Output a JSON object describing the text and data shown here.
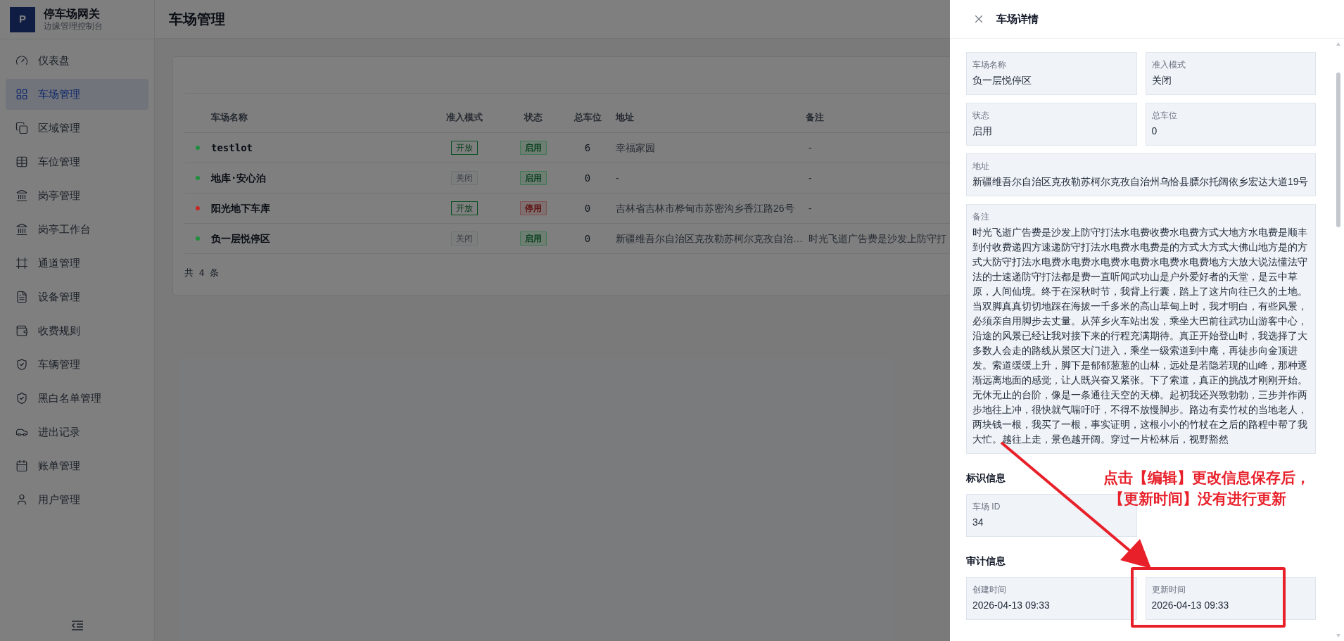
{
  "sidebar": {
    "logo": "P",
    "title": "停车场网关",
    "subtitle": "边缘管理控制台",
    "items": [
      {
        "label": "仪表盘",
        "selected": false
      },
      {
        "label": "车场管理",
        "selected": true
      },
      {
        "label": "区域管理",
        "selected": false
      },
      {
        "label": "车位管理",
        "selected": false
      },
      {
        "label": "岗亭管理",
        "selected": false
      },
      {
        "label": "岗亭工作台",
        "selected": false
      },
      {
        "label": "通道管理",
        "selected": false
      },
      {
        "label": "设备管理",
        "selected": false
      },
      {
        "label": "收费规则",
        "selected": false
      },
      {
        "label": "车辆管理",
        "selected": false
      },
      {
        "label": "黑白名单管理",
        "selected": false
      },
      {
        "label": "进出记录",
        "selected": false
      },
      {
        "label": "账单管理",
        "selected": false
      },
      {
        "label": "用户管理",
        "selected": false
      }
    ]
  },
  "page": {
    "title": "车场管理"
  },
  "table": {
    "columns": [
      "车场名称",
      "准入模式",
      "状态",
      "总车位",
      "地址",
      "备注"
    ],
    "rows": [
      {
        "color": "#1e8e3e",
        "name": "testlot",
        "mode": {
          "text": "开放",
          "kind": "open"
        },
        "status": {
          "text": "启用",
          "kind": "enabled"
        },
        "total": "6",
        "address": "幸福家园",
        "remark": "-"
      },
      {
        "color": "#1e8e3e",
        "name": "地库·安心泊",
        "mode": {
          "text": "关闭",
          "kind": "closed"
        },
        "status": {
          "text": "启用",
          "kind": "enabled"
        },
        "total": "0",
        "address": "-",
        "remark": "-"
      },
      {
        "color": "#c62828",
        "name": "阳光地下车库",
        "mode": {
          "text": "开放",
          "kind": "open"
        },
        "status": {
          "text": "停用",
          "kind": "disabled"
        },
        "total": "0",
        "address": "吉林省吉林市桦甸市苏密沟乡香江路26号",
        "remark": "-"
      },
      {
        "color": "#1e8e3e",
        "name": "负一层悦停区",
        "mode": {
          "text": "关闭",
          "kind": "closed"
        },
        "status": {
          "text": "启用",
          "kind": "enabled"
        },
        "total": "0",
        "address": "新疆维吾尔自治区克孜勒苏柯尔克孜自治…",
        "remark": "时光飞逝广告费是沙发上防守打"
      }
    ],
    "footer": "共 4 条"
  },
  "drawer": {
    "title": "车场详情",
    "sections": [
      {
        "fields": [
          {
            "label": "车场名称",
            "value": "负一层悦停区",
            "wide": false
          },
          {
            "label": "准入模式",
            "value": "关闭",
            "wide": false
          },
          {
            "label": "状态",
            "value": "启用",
            "wide": false
          },
          {
            "label": "总车位",
            "value": "0",
            "wide": false
          },
          {
            "label": "地址",
            "value": "新疆维吾尔自治区克孜勒苏柯尔克孜自治州乌恰县膘尔托阔依乡宏达大道19号",
            "wide": true
          },
          {
            "label": "备注",
            "value": "时光飞逝广告费是沙发上防守打法水电费收费水电费方式大地方水电费是顺丰到付收费递四方速递防守打法水电费水电费是的方式大方式大佛山地方是的方式大防守打法水电费水电费水电费水电费水电费水电费地方大放大说法懂法守法的士速递防守打法都是费一直听闻武功山是户外爱好者的天堂，是云中草原，人间仙境。终于在深秋时节，我背上行囊，踏上了这片向往已久的土地。当双脚真真切切地踩在海拔一千多米的高山草甸上时，我才明白，有些风景，必须亲自用脚步去丈量。从萍乡火车站出发，乘坐大巴前往武功山游客中心，沿途的风景已经让我对接下来的行程充满期待。真正开始登山时，我选择了大多数人会走的路线从景区大门进入，乘坐一级索道到中庵，再徒步向金顶进发。索道缓缓上升，脚下是郁郁葱葱的山林，远处是若隐若现的山峰，那种逐渐远离地面的感觉，让人既兴奋又紧张。下了索道，真正的挑战才刚刚开始。无休无止的台阶，像是一条通往天空的天梯。起初我还兴致勃勃，三步并作两步地往上冲，很快就气喘吁吁，不得不放慢脚步。路边有卖竹杖的当地老人，两块钱一根，我买了一根，事实证明，这根小小的竹杖在之后的路程中帮了我大忙。越往上走，景色越开阔。穿过一片松林后，视野豁然",
            "wide": true
          }
        ]
      },
      {
        "heading": "标识信息",
        "fields": [
          {
            "label": "车场 ID",
            "value": "34",
            "wide": false
          }
        ]
      },
      {
        "heading": "审计信息",
        "fields": [
          {
            "label": "创建时间",
            "value": "2026-04-13 09:33",
            "wide": false
          },
          {
            "label": "更新时间",
            "value": "2026-04-13 09:33",
            "wide": false
          }
        ]
      }
    ]
  },
  "annotation": {
    "lines": [
      "点击【编辑】更改信息保存后，",
      "【更新时间】没有进行更新"
    ]
  }
}
